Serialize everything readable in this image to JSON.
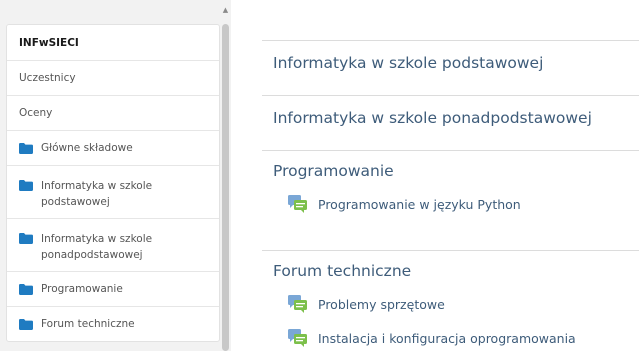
{
  "sidebar": {
    "course_short_name": "INFwSIECI",
    "items": [
      {
        "label": "Uczestnicy",
        "icon": null
      },
      {
        "label": "Oceny",
        "icon": null
      },
      {
        "label": "Główne składowe",
        "icon": "folder-icon"
      },
      {
        "label_line1": "Informatyka w szkole",
        "label_line2": "podstawowej",
        "icon": "folder-icon"
      },
      {
        "label_line1": "Informatyka w szkole",
        "label_line2": "ponadpodstawowej",
        "icon": "folder-icon"
      },
      {
        "label": "Programowanie",
        "icon": "folder-icon"
      },
      {
        "label": "Forum techniczne",
        "icon": "folder-icon"
      }
    ]
  },
  "main": {
    "sections": [
      {
        "title": "Informatyka w szkole podstawowej",
        "activities": []
      },
      {
        "title": "Informatyka w szkole ponadpodstawowej",
        "activities": []
      },
      {
        "title": "Programowanie",
        "activities": [
          {
            "label": "Programowanie w języku Python",
            "icon": "forum-icon"
          }
        ]
      },
      {
        "title": "Forum techniczne",
        "activities": [
          {
            "label": "Problemy sprzętowe",
            "icon": "forum-icon"
          },
          {
            "label": "Instalacja i konfiguracja oprogramowania",
            "icon": "forum-icon"
          }
        ]
      }
    ]
  },
  "colors": {
    "folder": "#1f7bc1",
    "link": "#3e5c7a",
    "forum_back": "#7aa7d6",
    "forum_front": "#7cc04b"
  }
}
